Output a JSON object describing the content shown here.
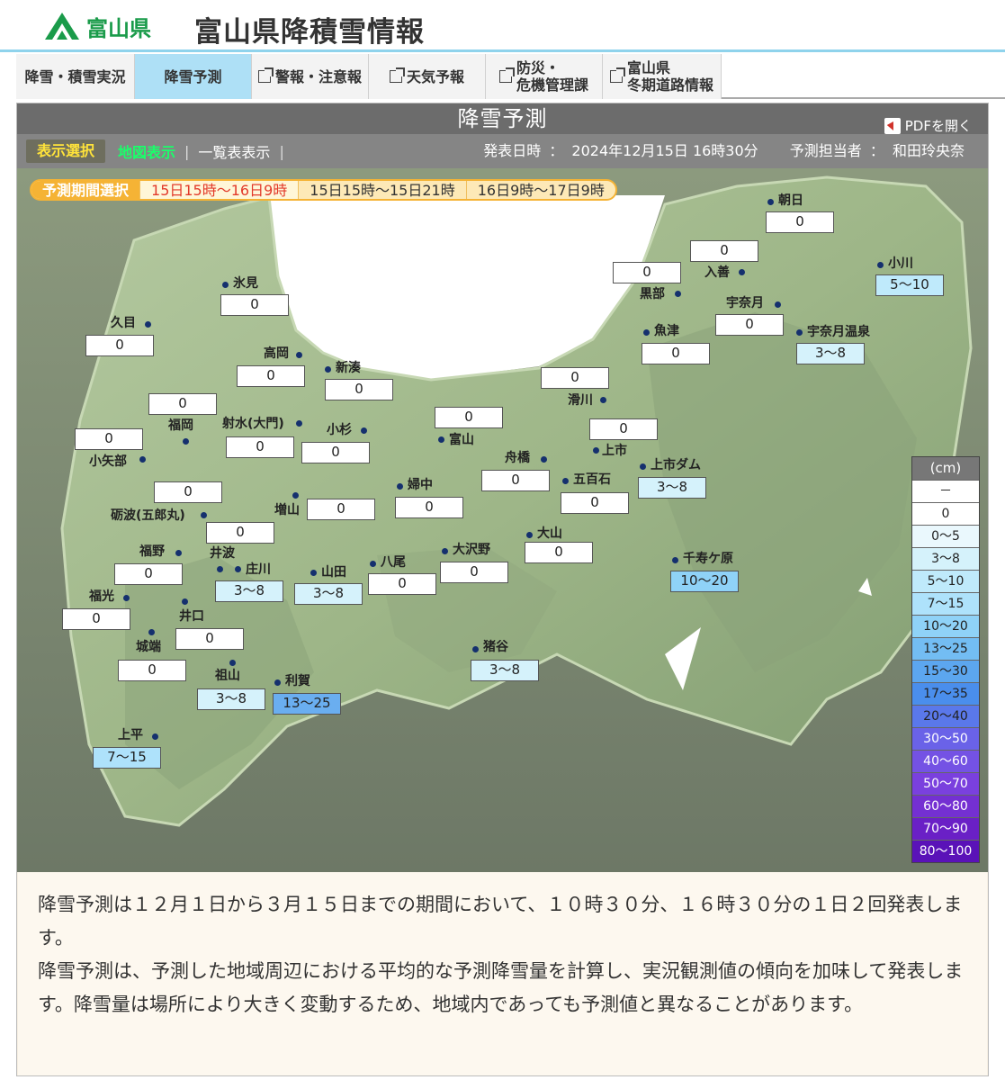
{
  "header": {
    "logo_text": "富山県",
    "site_title": "富山県降積雪情報"
  },
  "nav": [
    {
      "label": "降雪・積雪実況",
      "external": false
    },
    {
      "label": "降雪予測",
      "external": false
    },
    {
      "label": "警報・注意報",
      "external": true
    },
    {
      "label": "天気予報",
      "external": true
    },
    {
      "label": "防災・\n危機管理課",
      "external": true
    },
    {
      "label": "富山県\n冬期道路情報",
      "external": true
    }
  ],
  "panel": {
    "title": "降雪予測",
    "pdf_label": "PDFを開く",
    "toolbar": {
      "select_label": "表示選択",
      "map_label": "地図表示",
      "separator": "|",
      "list_label": "一覧表表示",
      "issued_label": "発表日時",
      "issued_value": "2024年12月15日 16時30分",
      "forecaster_label": "予測担当者",
      "forecaster_value": "和田玲央奈",
      "colon": "："
    },
    "period": {
      "label": "予測期間選択",
      "options": [
        "15日15時～16日9時",
        "15日15時～15日21時",
        "16日9時～17日9時"
      ]
    }
  },
  "stations": [
    {
      "name": "朝日",
      "value": "0"
    },
    {
      "name": "入善",
      "value": "0"
    },
    {
      "name": "黒部",
      "value": "0"
    },
    {
      "name": "小川",
      "value": "5～10"
    },
    {
      "name": "宇奈月",
      "value": "0"
    },
    {
      "name": "宇奈月温泉",
      "value": "3～8"
    },
    {
      "name": "魚津",
      "value": "0"
    },
    {
      "name": "滑川",
      "value": "0"
    },
    {
      "name": "上市",
      "value": "0"
    },
    {
      "name": "上市ダム",
      "value": "3～8"
    },
    {
      "name": "舟橋",
      "value": "0"
    },
    {
      "name": "五百石",
      "value": "0"
    },
    {
      "name": "富山",
      "value": "0"
    },
    {
      "name": "婦中",
      "value": "0"
    },
    {
      "name": "氷見",
      "value": "0"
    },
    {
      "name": "久目",
      "value": "0"
    },
    {
      "name": "高岡",
      "value": "0"
    },
    {
      "name": "新湊",
      "value": "0"
    },
    {
      "name": "福岡",
      "value": "0"
    },
    {
      "name": "射水(大門)",
      "value": "0"
    },
    {
      "name": "小杉",
      "value": "0"
    },
    {
      "name": "小矢部",
      "value": "0"
    },
    {
      "name": "砺波(五郎丸)",
      "value": "0"
    },
    {
      "name": "増山",
      "value": "0"
    },
    {
      "name": "福野",
      "value": "0"
    },
    {
      "name": "井波",
      "value": ""
    },
    {
      "name": "庄川",
      "value": "3～8"
    },
    {
      "name": "山田",
      "value": "3～8"
    },
    {
      "name": "八尾",
      "value": "0"
    },
    {
      "name": "大沢野",
      "value": "0"
    },
    {
      "name": "大山",
      "value": "0"
    },
    {
      "name": "千寿ケ原",
      "value": "10～20"
    },
    {
      "name": "福光",
      "value": "0"
    },
    {
      "name": "井口",
      "value": "0"
    },
    {
      "name": "城端",
      "value": "0"
    },
    {
      "name": "猪谷",
      "value": "3～8"
    },
    {
      "name": "利賀",
      "value": "13～25"
    },
    {
      "name": "祖山",
      "value": "3～8"
    },
    {
      "name": "上平",
      "value": "7～15"
    }
  ],
  "legend": {
    "unit": "(cm)",
    "items": [
      "－",
      "0",
      "0～5",
      "3～8",
      "5～10",
      "7～15",
      "10～20",
      "13～25",
      "15～30",
      "17～35",
      "20～40",
      "30～50",
      "40～60",
      "50～70",
      "60～80",
      "70～90",
      "80～100"
    ],
    "colors": [
      "#ffffff",
      "#ffffff",
      "#eaf8fd",
      "#d5f2fb",
      "#bfeafb",
      "#aee2fb",
      "#8fd2f7",
      "#73bdf3",
      "#5ca6ef",
      "#4a8eec",
      "#5a78ea",
      "#6a62e8",
      "#7452e4",
      "#7a40de",
      "#7430d2",
      "#6a20c6",
      "#5a12b8"
    ]
  },
  "notes": [
    "降雪予測は１２月１日から３月１５日までの期間において、１０時３０分、１６時３０分の１日２回発表します。",
    "降雪予測は、予測した地域周辺における平均的な予測降雪量を計算し、実況観測値の傾向を加味して発表します。降雪量は場所により大きく変動するため、地域内であっても予測値と異なることがあります。"
  ],
  "colors": {
    "accent": "#aee0f6",
    "brand_green": "#1a9b4a",
    "period_orange": "#f5b335"
  }
}
